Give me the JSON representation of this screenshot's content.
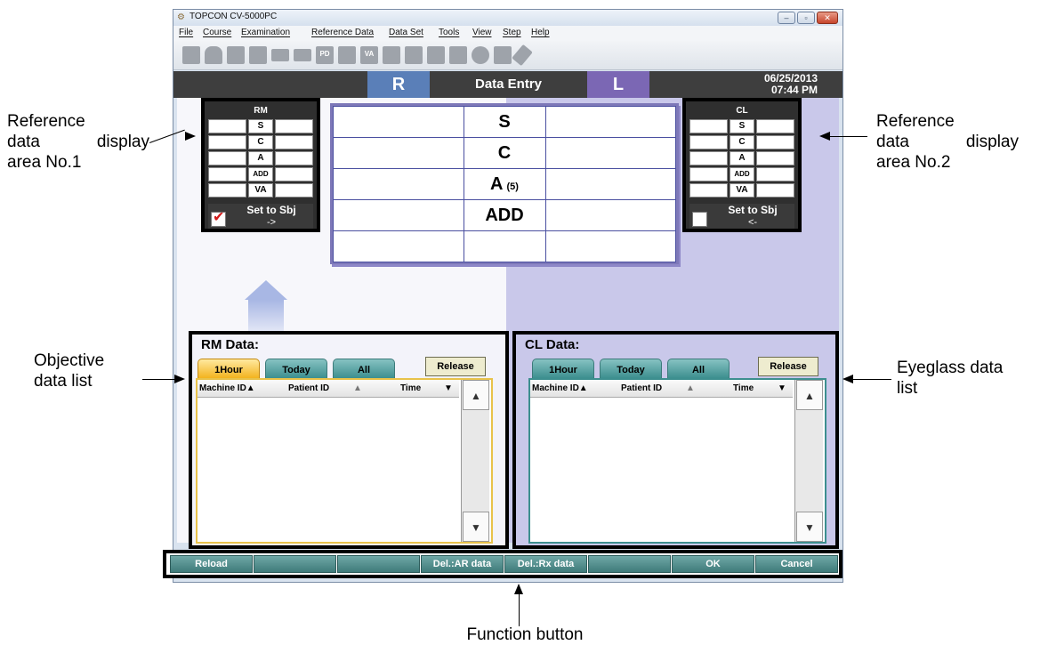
{
  "window": {
    "title": "TOPCON CV-5000PC",
    "controls": {
      "minimize": "–",
      "maximize": "▫",
      "close": "✕"
    }
  },
  "menu": [
    "File",
    "Course",
    "Examination",
    "Reference Data",
    "Data Set",
    "Tools",
    "View",
    "Step",
    "Help"
  ],
  "toolbar": {
    "icons": [
      "folder-icon",
      "person-icon",
      "phoropter-icon",
      "phoropter2-icon",
      "keyboard-icon",
      "card-icon",
      "pd-icon",
      "lens-icon",
      "va-icon",
      "chart-icon",
      "screen-icon",
      "screen2-icon",
      "book-icon",
      "circle-icon",
      "printer-icon",
      "wrench-icon"
    ],
    "pd_label": "PD",
    "va_label": "VA"
  },
  "header": {
    "right_eye": "R",
    "title": "Data Entry",
    "left_eye": "L",
    "date": "06/25/2013",
    "time": "07:44 PM"
  },
  "data_entry": {
    "params": [
      "S",
      "C",
      "A",
      "ADD",
      ""
    ],
    "axis_note": "(5)"
  },
  "reference_left": {
    "title": "RM",
    "keys": [
      "S",
      "C",
      "A",
      "ADD",
      "VA"
    ],
    "set_label": "Set to Sbj",
    "arrow": "->",
    "checked": true
  },
  "reference_right": {
    "title": "CL",
    "keys": [
      "S",
      "C",
      "A",
      "ADD",
      "VA"
    ],
    "set_label": "Set to Sbj",
    "arrow": "<-",
    "checked": false
  },
  "rm_list": {
    "title": "RM Data:",
    "tabs": [
      "1Hour",
      "Today",
      "All"
    ],
    "active_tab": "1Hour",
    "release": "Release",
    "columns": [
      "Machine ID▲",
      "Patient ID",
      "▲",
      "Time",
      "▼"
    ]
  },
  "cl_list": {
    "title": "CL Data:",
    "tabs": [
      "1Hour",
      "Today",
      "All"
    ],
    "release": "Release",
    "columns": [
      "Machine ID▲",
      "Patient ID",
      "▲",
      "Time",
      "▼"
    ]
  },
  "function_buttons": [
    "Reload",
    "",
    "",
    "Del.:AR data",
    "Del.:Rx data",
    "",
    "OK",
    "Cancel"
  ],
  "callouts": {
    "ref1": [
      "Reference",
      "data",
      "display",
      "area No.1"
    ],
    "ref2": [
      "Reference",
      "data",
      "display",
      "area No.2"
    ],
    "objective": [
      "Objective",
      "data list"
    ],
    "eyeglass": [
      "Eyeglass data",
      "list"
    ],
    "function": "Function button"
  },
  "colors": {
    "right_eye": "#5a7fb8",
    "left_eye": "#7b67b4",
    "active_tab": "#f3b31e",
    "tab": "#3d8f8f",
    "function_button": "#3f7b7a"
  }
}
